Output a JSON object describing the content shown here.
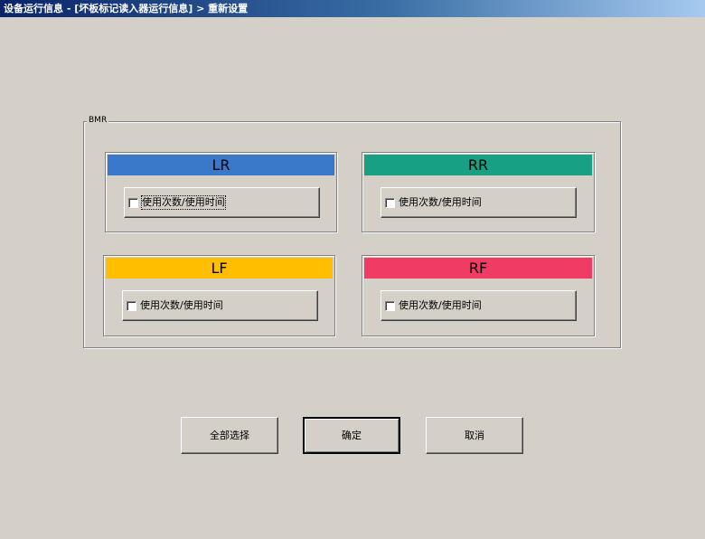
{
  "window": {
    "title": "设备运行信息 - [坏板标记读入器运行信息] > 重新设置"
  },
  "group": {
    "label": "BMR"
  },
  "panels": {
    "lr": {
      "header": "LR",
      "color": "#3a78c9",
      "checkbox_label": "使用次数/使用时间",
      "checked": false
    },
    "rr": {
      "header": "RR",
      "color": "#18a085",
      "checkbox_label": "使用次数/使用时间",
      "checked": false
    },
    "lf": {
      "header": "LF",
      "color": "#ffbf00",
      "checkbox_label": "使用次数/使用时间",
      "checked": false
    },
    "rf": {
      "header": "RF",
      "color": "#f03c64",
      "checkbox_label": "使用次数/使用时间",
      "checked": false
    }
  },
  "buttons": {
    "select_all": "全部选择",
    "ok": "确定",
    "cancel": "取消"
  }
}
